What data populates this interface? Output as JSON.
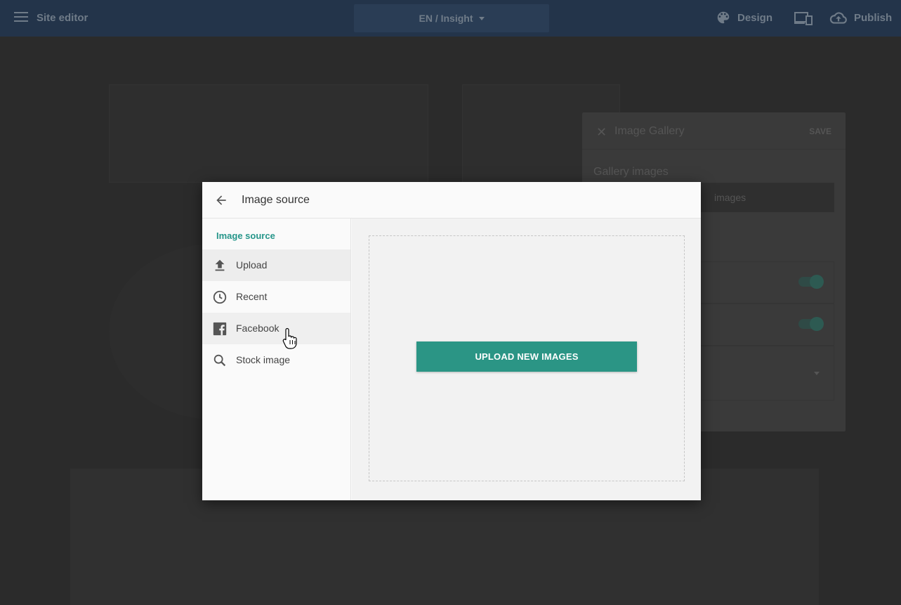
{
  "topbar": {
    "title": "Site editor",
    "language_selector": "EN / Insight",
    "design_label": "Design",
    "publish_label": "Publish"
  },
  "gallery_panel": {
    "title": "Image Gallery",
    "save_label": "SAVE",
    "section_label": "Gallery images",
    "button_fragment": "images"
  },
  "dialog": {
    "title": "Image source",
    "nav_heading": "Image source",
    "nav_items": [
      {
        "label": "Upload",
        "icon": "upload-icon"
      },
      {
        "label": "Recent",
        "icon": "clock-icon"
      },
      {
        "label": "Facebook",
        "icon": "facebook-icon"
      },
      {
        "label": "Stock image",
        "icon": "search-icon"
      }
    ],
    "selected_item": "Upload",
    "upload_button": "UPLOAD NEW IMAGES"
  },
  "colors": {
    "accent": "#2b9585",
    "topbar": "#23344a"
  }
}
